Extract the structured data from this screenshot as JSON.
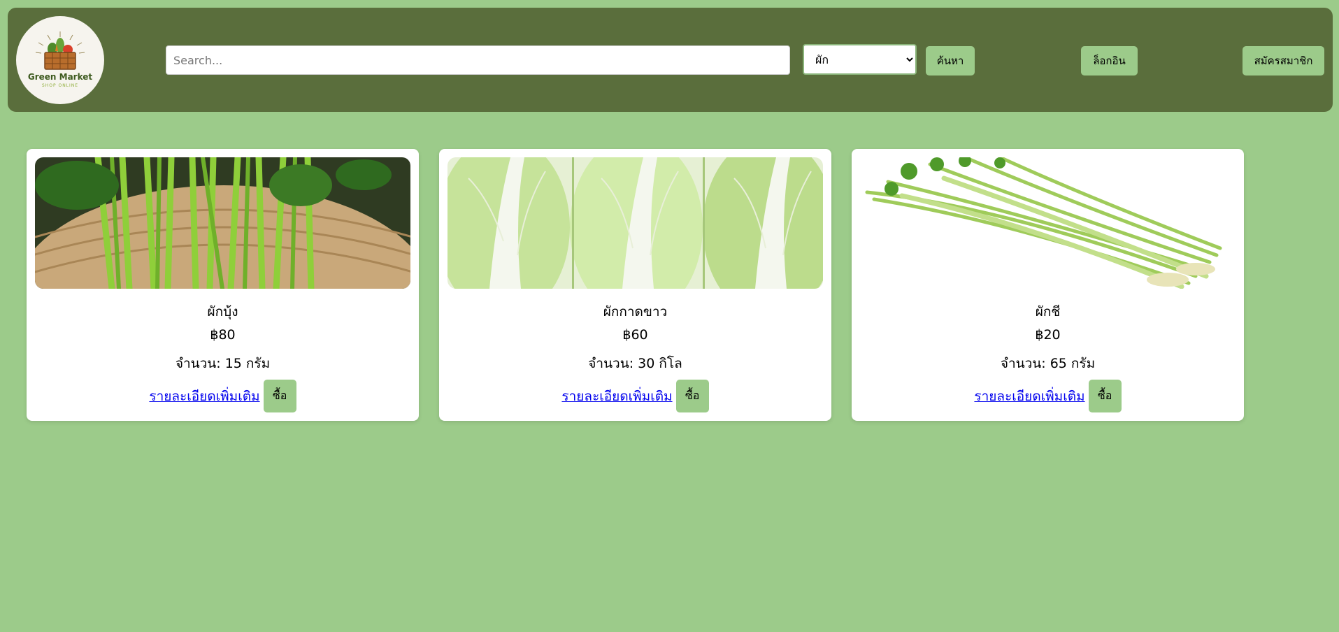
{
  "header": {
    "logo": {
      "title": "Green Market",
      "subtitle": "SHOP ONLINE",
      "icon": "vegetable-basket-icon"
    },
    "search": {
      "placeholder": "Search...",
      "value": ""
    },
    "category": {
      "selected": "ผัก"
    },
    "search_button": "ค้นหา",
    "login_button": "ล็อกอิน",
    "register_button": "สมัครสมาชิก"
  },
  "products": [
    {
      "name": "ผักบุ้ง",
      "price": "฿80",
      "quantity": "จำนวน: 15 กรัม",
      "detail_link": "รายละเอียดเพิ่มเติม",
      "buy_label": "ซื้อ"
    },
    {
      "name": "ผักกาดขาว",
      "price": "฿60",
      "quantity": "จำนวน: 30 กิโล",
      "detail_link": "รายละเอียดเพิ่มเติม",
      "buy_label": "ซื้อ"
    },
    {
      "name": "ผักชี",
      "price": "฿20",
      "quantity": "จำนวน: 65 กรัม",
      "detail_link": "รายละเอียดเพิ่มเติม",
      "buy_label": "ซื้อ"
    }
  ],
  "colors": {
    "page_bg": "#9ccb8a",
    "header_bg": "#5a6e3c",
    "button_bg": "#9ccb8a",
    "link": "#0000ee"
  }
}
